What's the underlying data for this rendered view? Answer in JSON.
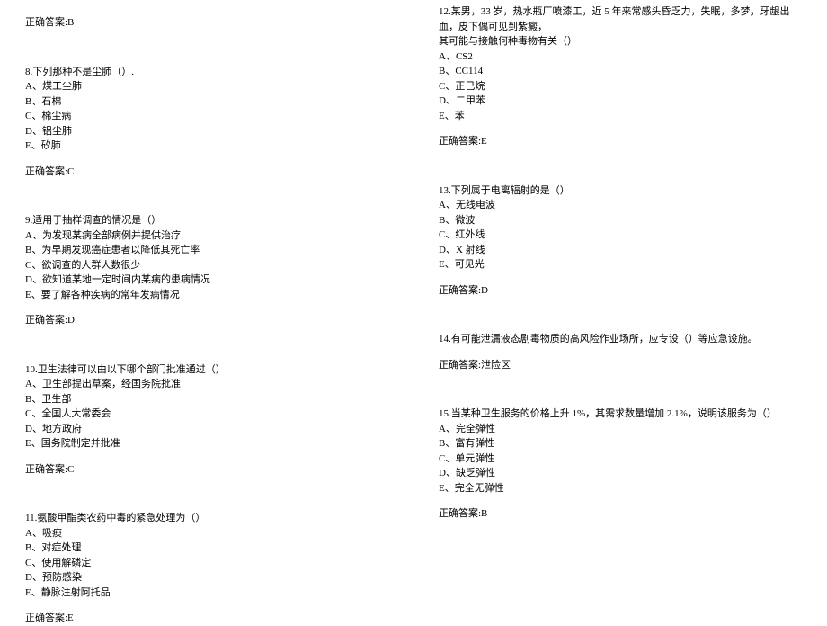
{
  "left": {
    "q7_answer": "正确答案:B",
    "q8": {
      "stem": "8.下列那种不是尘肺（）.",
      "options": [
        "A、煤工尘肺",
        "B、石棉",
        "C、棉尘病",
        "D、铝尘肺",
        "E、矽肺"
      ],
      "answer": "正确答案:C"
    },
    "q9": {
      "stem": "9.适用于抽样调查的情况是（）",
      "options": [
        "A、为发现某病全部病例并提供治疗",
        "B、为早期发现癌症患者以降低其死亡率",
        "C、欲调查的人群人数很少",
        "D、欲知道某地一定时间内某病的患病情况",
        "E、要了解各种疾病的常年发病情况"
      ],
      "answer": "正确答案:D"
    },
    "q10": {
      "stem": "10.卫生法律可以由以下哪个部门批准通过（）",
      "options": [
        "A、卫生部提出草案，经国务院批准",
        "B、卫生部",
        "C、全国人大常委会",
        "D、地方政府",
        "E、国务院制定并批准"
      ],
      "answer": "正确答案:C"
    },
    "q11": {
      "stem": "11.氨酸甲酯类农药中毒的紧急处理为（）",
      "options": [
        "A、吸痰",
        "B、对症处理",
        "C、使用解磷定",
        "D、预防感染",
        "E、静脉注射阿托品"
      ],
      "answer": "正确答案:E"
    }
  },
  "right": {
    "q12": {
      "stem_line1": "12.某男，33 岁，热水瓶厂喷漆工，近 5 年来常感头昏乏力，失眠，多梦，牙龈出血，皮下偶可见到紫癜，",
      "stem_line2": "其可能与接触何种毒物有关（）",
      "options": [
        "A、CS2",
        "B、CC114",
        "C、正己烷",
        "D、二甲苯",
        "E、苯"
      ],
      "answer": "正确答案:E"
    },
    "q13": {
      "stem": "13.下列属于电离辐射的是（）",
      "options": [
        "A、无线电波",
        "B、微波",
        "C、红外线",
        "D、X 射线",
        "E、可见光"
      ],
      "answer": "正确答案:D"
    },
    "q14": {
      "stem": "14.有可能泄漏液态剧毒物质的高风险作业场所，应专设（）等应急设施。",
      "answer": "正确答案:泄险区"
    },
    "q15": {
      "stem": "15.当某种卫生服务的价格上升 1%，其需求数量增加 2.1%，说明该服务为（）",
      "options": [
        "A、完全弹性",
        "B、富有弹性",
        "C、单元弹性",
        "D、缺乏弹性",
        "E、完全无弹性"
      ],
      "answer": "正确答案:B"
    }
  }
}
